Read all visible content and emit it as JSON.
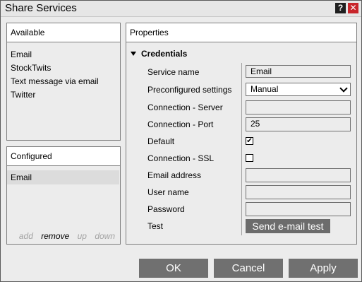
{
  "window": {
    "title": "Share Services",
    "help_label": "?",
    "close_label": "✕"
  },
  "available": {
    "header": "Available",
    "items": [
      "Email",
      "StockTwits",
      "Text message via email",
      "Twitter"
    ]
  },
  "configured": {
    "header": "Configured",
    "items": [
      "Email"
    ],
    "actions": {
      "add": "add",
      "remove": "remove",
      "up": "up",
      "down": "down"
    }
  },
  "properties": {
    "header": "Properties",
    "section": "Credentials",
    "fields": {
      "service_name": {
        "label": "Service name",
        "value": "Email"
      },
      "preconfigured": {
        "label": "Preconfigured settings",
        "value": "Manual"
      },
      "server": {
        "label": "Connection - Server",
        "value": ""
      },
      "port": {
        "label": "Connection - Port",
        "value": "25"
      },
      "default": {
        "label": "Default",
        "checked": true,
        "mark": "✔"
      },
      "ssl": {
        "label": "Connection - SSL",
        "checked": false,
        "mark": ""
      },
      "email": {
        "label": "Email address",
        "value": ""
      },
      "user": {
        "label": "User name",
        "value": ""
      },
      "password": {
        "label": "Password",
        "value": ""
      },
      "test": {
        "label": "Test",
        "button": "Send e-mail test"
      }
    }
  },
  "buttons": {
    "ok": "OK",
    "cancel": "Cancel",
    "apply": "Apply"
  },
  "colors": {
    "button": "#707070",
    "selected_row": "#dcdcdc",
    "close": "#c8252b"
  }
}
